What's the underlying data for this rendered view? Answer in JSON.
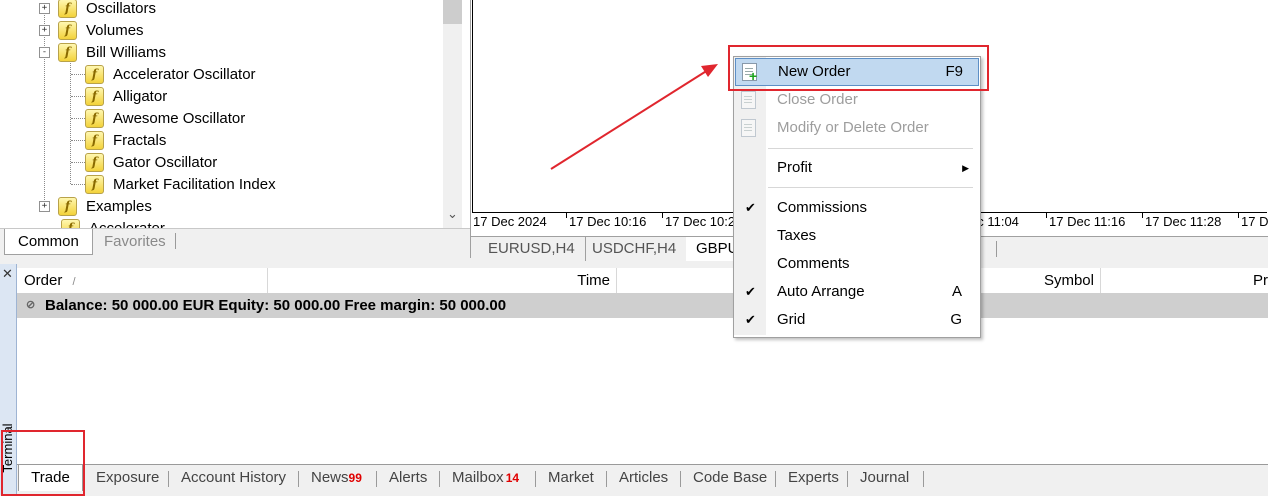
{
  "navigator": {
    "items": [
      {
        "label": "Oscillators",
        "level": 0,
        "expander": "+"
      },
      {
        "label": "Volumes",
        "level": 0,
        "expander": "+"
      },
      {
        "label": "Bill Williams",
        "level": 0,
        "expander": "-"
      },
      {
        "label": "Accelerator Oscillator",
        "level": 1
      },
      {
        "label": "Alligator",
        "level": 1
      },
      {
        "label": "Awesome Oscillator",
        "level": 1
      },
      {
        "label": "Fractals",
        "level": 1
      },
      {
        "label": "Gator Oscillator",
        "level": 1
      },
      {
        "label": "Market Facilitation Index",
        "level": 1
      },
      {
        "label": "Examples",
        "level": 0,
        "expander": "+"
      },
      {
        "label": "Accelerator",
        "level": 1
      }
    ],
    "tabs": [
      "Common",
      "Favorites"
    ],
    "active_tab": "Common"
  },
  "chart": {
    "time_labels": [
      "17 Dec 2024",
      "17 Dec 10:16",
      "17 Dec 10:2",
      "ec 11:04",
      "17 Dec 11:16",
      "17 Dec 11:28",
      "17 D"
    ],
    "tabs": [
      "EURUSD,H4",
      "USDCHF,H4",
      "GBPU"
    ],
    "active_tab": "GBPU"
  },
  "context_menu": {
    "items": [
      {
        "label": "New Order",
        "shortcut": "F9",
        "state": "highlighted",
        "icon": "new-order-icon"
      },
      {
        "label": "Close Order",
        "shortcut": "",
        "state": "disabled",
        "icon": "close-order-icon"
      },
      {
        "label": "Modify or Delete Order",
        "shortcut": "",
        "state": "disabled",
        "icon": "modify-order-icon"
      },
      {
        "label": "Profit",
        "shortcut": "",
        "state": "submenu"
      },
      {
        "label": "Commissions",
        "shortcut": "",
        "state": "checked"
      },
      {
        "label": "Taxes",
        "shortcut": "",
        "state": "normal"
      },
      {
        "label": "Comments",
        "shortcut": "",
        "state": "normal"
      },
      {
        "label": "Auto Arrange",
        "shortcut": "A",
        "state": "checked"
      },
      {
        "label": "Grid",
        "shortcut": "G",
        "state": "checked"
      }
    ]
  },
  "terminal": {
    "side_label": "Terminal",
    "columns": [
      "Order",
      "Time",
      "Symbol",
      "Pr"
    ],
    "sort_indicator": "/",
    "balance_text": "Balance: 50 000.00 EUR  Equity: 50 000.00  Free margin: 50 000.00",
    "tabs": [
      {
        "label": "Trade",
        "badge": ""
      },
      {
        "label": "Exposure",
        "badge": ""
      },
      {
        "label": "Account History",
        "badge": ""
      },
      {
        "label": "News",
        "badge": "99"
      },
      {
        "label": "Alerts",
        "badge": ""
      },
      {
        "label": "Mailbox",
        "badge": "14"
      },
      {
        "label": "Market",
        "badge": ""
      },
      {
        "label": "Articles",
        "badge": ""
      },
      {
        "label": "Code Base",
        "badge": ""
      },
      {
        "label": "Experts",
        "badge": ""
      },
      {
        "label": "Journal",
        "badge": ""
      }
    ],
    "active_tab": "Trade"
  },
  "colors": {
    "highlight_box": "#e0262e",
    "menu_hover": "#c1d9f0",
    "badge": "#e00000"
  }
}
